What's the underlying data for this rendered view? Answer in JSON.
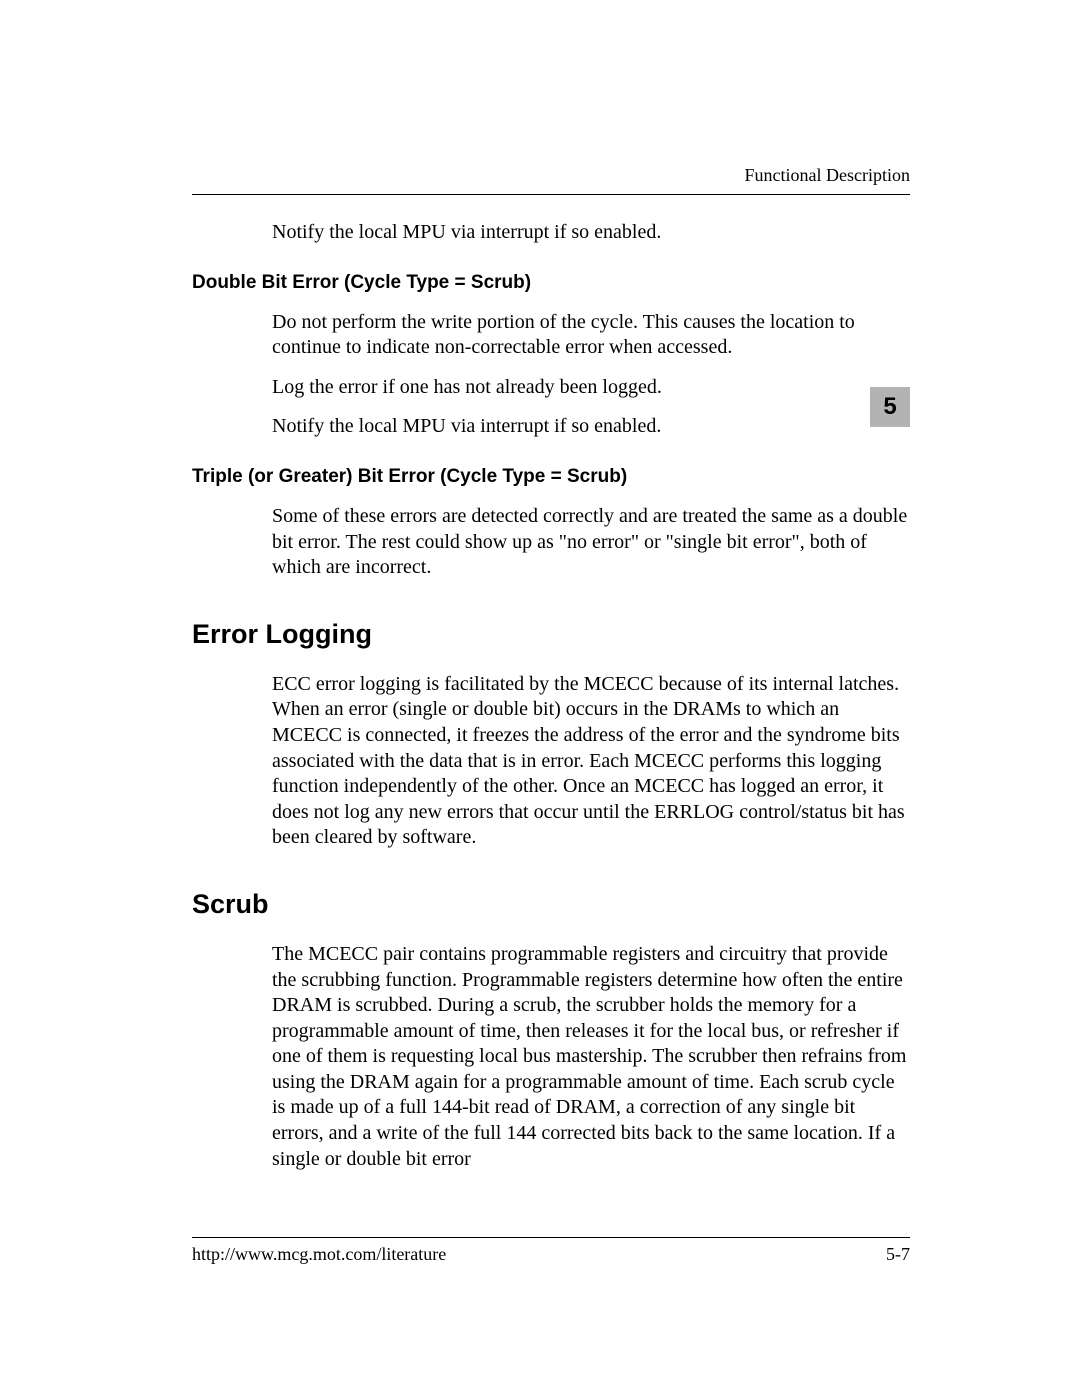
{
  "header": {
    "section_label": "Functional Description"
  },
  "chapter_tab": "5",
  "intro_paragraph": "Notify the local MPU via interrupt if so enabled.",
  "double_bit": {
    "heading": "Double Bit Error (Cycle Type = Scrub)",
    "p1": "Do not perform the write portion of the cycle. This causes the location to continue to indicate non-correctable error when accessed.",
    "p2": "Log the error if one has not already been logged.",
    "p3": "Notify the local MPU via interrupt if so enabled."
  },
  "triple_bit": {
    "heading": "Triple (or Greater) Bit Error (Cycle Type = Scrub)",
    "p1": "Some of these errors are detected correctly and are treated the same as a double bit error. The rest could show up as \"no error\" or \"single bit error\", both of which are incorrect."
  },
  "error_logging": {
    "heading": "Error Logging",
    "p1": "ECC error logging is facilitated by the MCECC because of its internal latches. When an error (single or double bit) occurs in the DRAMs to which an MCECC is connected, it freezes the address of the error and the syndrome bits associated with the data that is in error. Each MCECC performs this logging function independently of the other. Once an MCECC has logged an error, it does not log any new errors that occur until the ERRLOG control/status bit has been cleared by software."
  },
  "scrub": {
    "heading": "Scrub",
    "p1": "The MCECC pair contains programmable registers and circuitry that provide the scrubbing function. Programmable registers determine how often the entire DRAM is scrubbed. During a scrub, the scrubber holds the memory for a programmable amount of time, then releases it for the local bus, or refresher if one of them is requesting local bus mastership. The scrubber then refrains from using the DRAM again for a programmable amount of time. Each scrub cycle is made up of a full 144-bit read of DRAM, a correction of any single bit errors, and a write of the full 144 corrected bits back to the same location. If a single or double bit error"
  },
  "footer": {
    "url": "http://www.mcg.mot.com/literature",
    "page_number": "5-7"
  }
}
